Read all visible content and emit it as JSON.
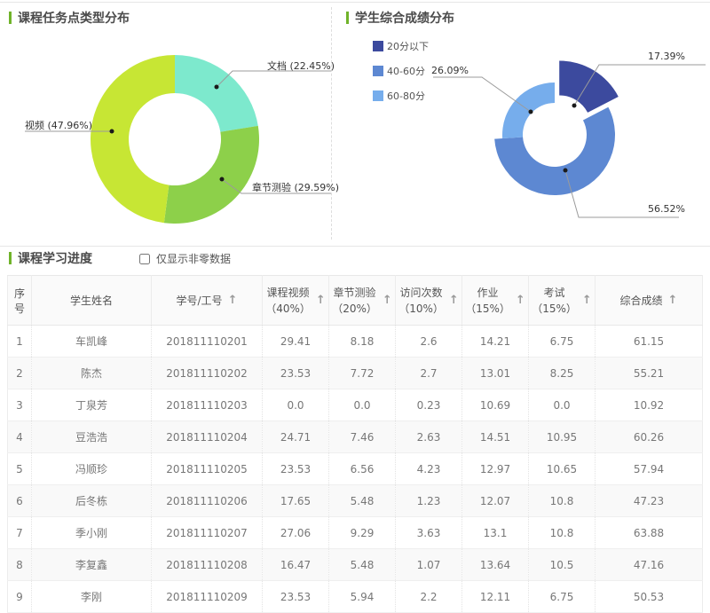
{
  "colors": {
    "accent_green": "#70b32a"
  },
  "sections": {
    "task_chart": {
      "title": "课程任务点类型分布"
    },
    "score_chart": {
      "title": "学生综合成绩分布"
    },
    "progress": {
      "title": "课程学习进度",
      "filter_label": "仅显示非零数据"
    }
  },
  "chart_data": [
    {
      "type": "pie",
      "subtype": "donut",
      "title": "课程任务点类型分布",
      "segments": [
        {
          "label": "文档",
          "value": 22.45,
          "display": "文档 (22.45%)",
          "color": "#7de9cd"
        },
        {
          "label": "章节测验",
          "value": 29.59,
          "display": "章节测验 (29.59%)",
          "color": "#8dd04a"
        },
        {
          "label": "视频",
          "value": 47.96,
          "display": "视频 (47.96%)",
          "color": "#c7e634"
        }
      ]
    },
    {
      "type": "pie",
      "subtype": "donut-rose",
      "title": "学生综合成绩分布",
      "legend_position": "top-left",
      "segments": [
        {
          "label": "20分以下",
          "value": 17.39,
          "display": "17.39%",
          "color": "#3c4a9e",
          "exploded": true
        },
        {
          "label": "40-60分",
          "value": 56.52,
          "display": "56.52%",
          "color": "#5d88d2"
        },
        {
          "label": "60-80分",
          "value": 26.09,
          "display": "26.09%",
          "color": "#76adec"
        }
      ]
    }
  ],
  "table": {
    "sort_icon": "↑",
    "columns": [
      {
        "label": "序号"
      },
      {
        "label": "学生姓名"
      },
      {
        "label": "学号/工号",
        "sortable": true
      },
      {
        "label": "课程视频",
        "sub": "（40%）",
        "sortable": true
      },
      {
        "label": "章节测验",
        "sub": "（20%）",
        "sortable": true
      },
      {
        "label": "访问次数",
        "sub": "（10%）",
        "sortable": true
      },
      {
        "label": "作业",
        "sub": "（15%）",
        "sortable": true
      },
      {
        "label": "考试",
        "sub": "（15%）",
        "sortable": true
      },
      {
        "label": "综合成绩",
        "sortable": true
      }
    ],
    "rows": [
      [
        "1",
        "车凯峰",
        "201811110201",
        "29.41",
        "8.18",
        "2.6",
        "14.21",
        "6.75",
        "61.15"
      ],
      [
        "2",
        "陈杰",
        "201811110202",
        "23.53",
        "7.72",
        "2.7",
        "13.01",
        "8.25",
        "55.21"
      ],
      [
        "3",
        "丁泉芳",
        "201811110203",
        "0.0",
        "0.0",
        "0.23",
        "10.69",
        "0.0",
        "10.92"
      ],
      [
        "4",
        "豆浩浩",
        "201811110204",
        "24.71",
        "7.46",
        "2.63",
        "14.51",
        "10.95",
        "60.26"
      ],
      [
        "5",
        "冯顺珍",
        "201811110205",
        "23.53",
        "6.56",
        "4.23",
        "12.97",
        "10.65",
        "57.94"
      ],
      [
        "6",
        "后冬栋",
        "201811110206",
        "17.65",
        "5.48",
        "1.23",
        "12.07",
        "10.8",
        "47.23"
      ],
      [
        "7",
        "季小刚",
        "201811110207",
        "27.06",
        "9.29",
        "3.63",
        "13.1",
        "10.8",
        "63.88"
      ],
      [
        "8",
        "李复鑫",
        "201811110208",
        "16.47",
        "5.48",
        "1.07",
        "13.64",
        "10.5",
        "47.16"
      ],
      [
        "9",
        "李刚",
        "201811110209",
        "23.53",
        "5.94",
        "2.2",
        "12.11",
        "6.75",
        "50.53"
      ]
    ]
  }
}
